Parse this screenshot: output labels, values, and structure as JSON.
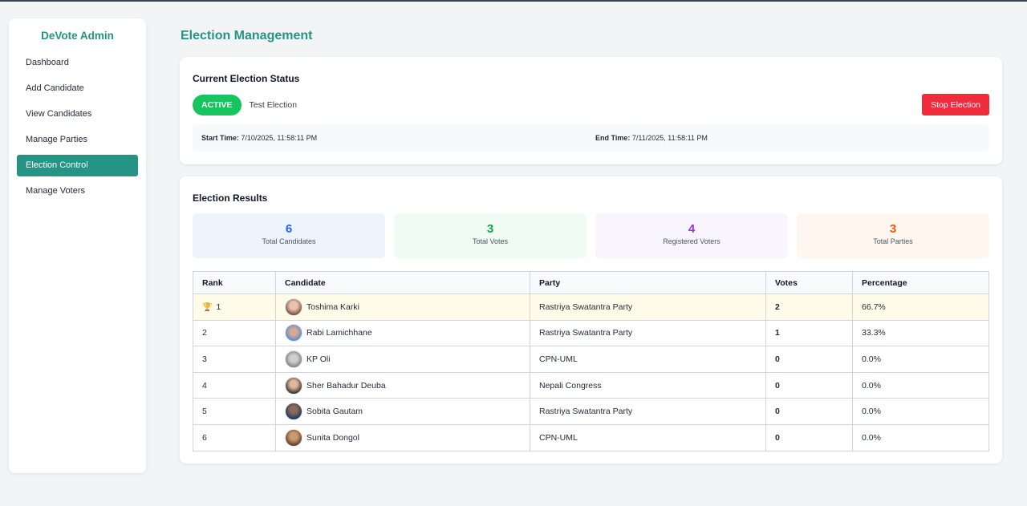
{
  "sidebar": {
    "brand": "DeVote Admin",
    "items": [
      {
        "label": "Dashboard"
      },
      {
        "label": "Add Candidate"
      },
      {
        "label": "View Candidates"
      },
      {
        "label": "Manage Parties"
      },
      {
        "label": "Election Control"
      },
      {
        "label": "Manage Voters"
      }
    ],
    "active_index": 4
  },
  "page": {
    "title": "Election Management"
  },
  "status": {
    "title": "Current Election Status",
    "badge": "ACTIVE",
    "election_name": "Test Election",
    "stop_label": "Stop Election",
    "start_label": "Start Time:",
    "start_value": "7/10/2025, 11:58:11 PM",
    "end_label": "End Time:",
    "end_value": "7/11/2025, 11:58:11 PM"
  },
  "results": {
    "title": "Election Results",
    "stats": [
      {
        "value": "6",
        "label": "Total Candidates",
        "color": "#2563eb",
        "bg": "#eef4fe"
      },
      {
        "value": "3",
        "label": "Total Votes",
        "color": "#16a34a",
        "bg": "#f0fbf4"
      },
      {
        "value": "4",
        "label": "Registered Voters",
        "color": "#9333ea",
        "bg": "#f9f5fe"
      },
      {
        "value": "3",
        "label": "Total Parties",
        "color": "#ea580c",
        "bg": "#fff7ef"
      }
    ],
    "columns": [
      "Rank",
      "Candidate",
      "Party",
      "Votes",
      "Percentage"
    ],
    "rows": [
      {
        "rank": "1",
        "name": "Toshima Karki",
        "party": "Rastriya Swatantra Party",
        "votes": "2",
        "pct": "66.7%",
        "leader": true
      },
      {
        "rank": "2",
        "name": "Rabi Lamichhane",
        "party": "Rastriya Swatantra Party",
        "votes": "1",
        "pct": "33.3%"
      },
      {
        "rank": "3",
        "name": "KP Oli",
        "party": "CPN-UML",
        "votes": "0",
        "pct": "0.0%"
      },
      {
        "rank": "4",
        "name": "Sher Bahadur Deuba",
        "party": "Nepali Congress",
        "votes": "0",
        "pct": "0.0%"
      },
      {
        "rank": "5",
        "name": "Sobita Gautam",
        "party": "Rastriya Swatantra Party",
        "votes": "0",
        "pct": "0.0%"
      },
      {
        "rank": "6",
        "name": "Sunita Dongol",
        "party": "CPN-UML",
        "votes": "0",
        "pct": "0.0%"
      }
    ]
  }
}
